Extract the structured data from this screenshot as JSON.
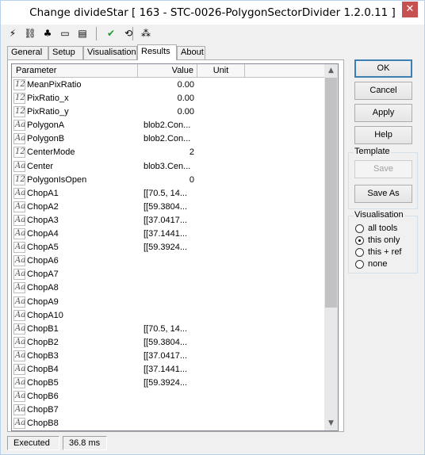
{
  "window": {
    "title": "Change divideStar [ 163 - STC-0026-PolygonSectorDivider 1.2.0.11 ]",
    "close_glyph": "✕"
  },
  "toolbar": {
    "icons": [
      {
        "name": "lightning-icon",
        "glyph": "⚡"
      },
      {
        "name": "link-icon",
        "glyph": "⛓"
      },
      {
        "name": "puzzle-icon",
        "glyph": "♣"
      },
      {
        "name": "console-icon",
        "glyph": "▭"
      },
      {
        "name": "document-icon",
        "glyph": "▤"
      },
      {
        "name": "checkmark-icon",
        "glyph": "✔"
      },
      {
        "name": "run-icon",
        "glyph": "⟲"
      },
      {
        "name": "network-icon",
        "glyph": "⁂"
      }
    ]
  },
  "tabs": [
    "General",
    "Setup",
    "Visualisation",
    "Results",
    "About"
  ],
  "active_tab": "Results",
  "grid": {
    "columns": [
      "Parameter",
      "Value",
      "Unit"
    ],
    "rows": [
      {
        "type": "12",
        "name": "MeanPixRatio",
        "value": "0.00",
        "num": true
      },
      {
        "type": "12",
        "name": "PixRatio_x",
        "value": "0.00",
        "num": true
      },
      {
        "type": "12",
        "name": "PixRatio_y",
        "value": "0.00",
        "num": true
      },
      {
        "type": "Aa",
        "name": "PolygonA",
        "value": "blob2.Con...",
        "num": false
      },
      {
        "type": "Aa",
        "name": "PolygonB",
        "value": "blob2.Con...",
        "num": false
      },
      {
        "type": "12",
        "name": "CenterMode",
        "value": "2",
        "num": true
      },
      {
        "type": "Aa",
        "name": "Center",
        "value": "blob3.Cen...",
        "num": false
      },
      {
        "type": "12",
        "name": "PolygonIsOpen",
        "value": "0",
        "num": true
      },
      {
        "type": "Aa",
        "name": "ChopA1",
        "value": "[[70.5, 14...",
        "num": false
      },
      {
        "type": "Aa",
        "name": "ChopA2",
        "value": "[[59.3804...",
        "num": false
      },
      {
        "type": "Aa",
        "name": "ChopA3",
        "value": "[[37.0417...",
        "num": false
      },
      {
        "type": "Aa",
        "name": "ChopA4",
        "value": "[[37.1441...",
        "num": false
      },
      {
        "type": "Aa",
        "name": "ChopA5",
        "value": "[[59.3924...",
        "num": false
      },
      {
        "type": "Aa",
        "name": "ChopA6",
        "value": "",
        "num": false
      },
      {
        "type": "Aa",
        "name": "ChopA7",
        "value": "",
        "num": false
      },
      {
        "type": "Aa",
        "name": "ChopA8",
        "value": "",
        "num": false
      },
      {
        "type": "Aa",
        "name": "ChopA9",
        "value": "",
        "num": false
      },
      {
        "type": "Aa",
        "name": "ChopA10",
        "value": "",
        "num": false
      },
      {
        "type": "Aa",
        "name": "ChopB1",
        "value": "[[70.5, 14...",
        "num": false
      },
      {
        "type": "Aa",
        "name": "ChopB2",
        "value": "[[59.3804...",
        "num": false
      },
      {
        "type": "Aa",
        "name": "ChopB3",
        "value": "[[37.0417...",
        "num": false
      },
      {
        "type": "Aa",
        "name": "ChopB4",
        "value": "[[37.1441...",
        "num": false
      },
      {
        "type": "Aa",
        "name": "ChopB5",
        "value": "[[59.3924...",
        "num": false
      },
      {
        "type": "Aa",
        "name": "ChopB6",
        "value": "",
        "num": false
      },
      {
        "type": "Aa",
        "name": "ChopB7",
        "value": "",
        "num": false
      },
      {
        "type": "Aa",
        "name": "ChopB8",
        "value": "",
        "num": false
      }
    ]
  },
  "buttons": {
    "ok": "OK",
    "cancel": "Cancel",
    "apply": "Apply",
    "help": "Help"
  },
  "template_group": {
    "label": "Template",
    "save": "Save",
    "save_as": "Save As"
  },
  "visualisation_group": {
    "label": "Visualisation",
    "options": [
      "all tools",
      "this only",
      "this + ref",
      "none"
    ],
    "selected": "this only"
  },
  "status": {
    "state": "Executed",
    "time": "36.8 ms"
  },
  "colors": {
    "accent": "#3c7fb1",
    "close": "#c75050",
    "check": "#1a9c2a"
  }
}
